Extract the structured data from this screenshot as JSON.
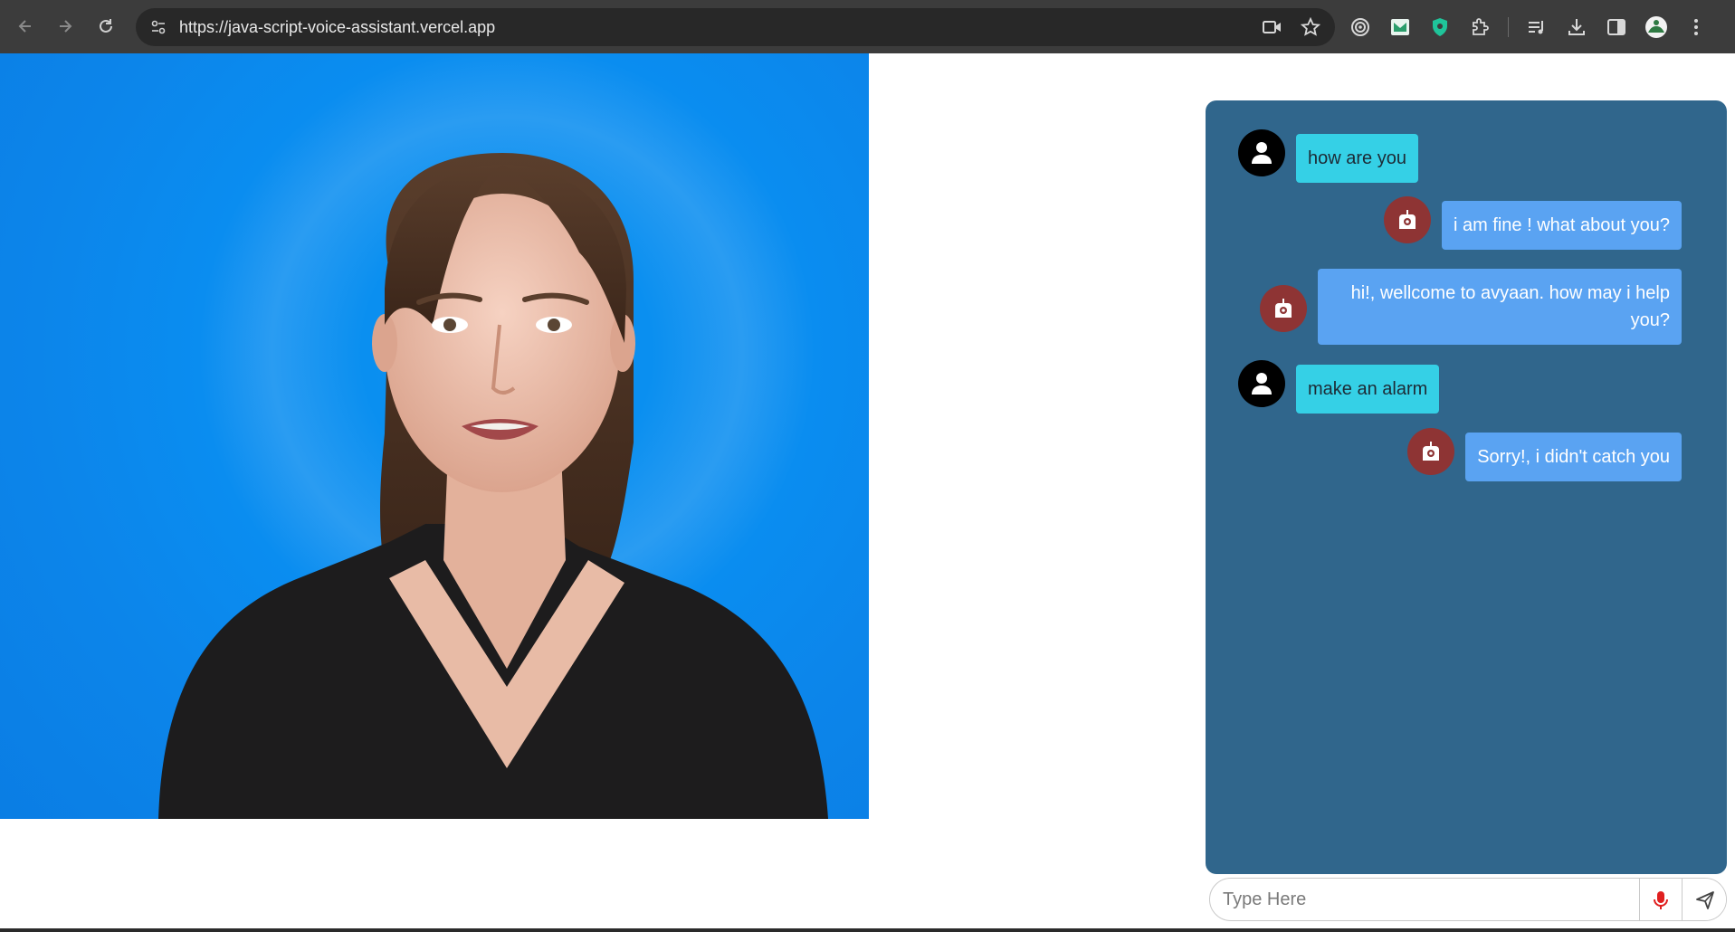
{
  "browser": {
    "url": "https://java-script-voice-assistant.vercel.app",
    "icons": [
      "back-arrow-icon",
      "forward-arrow-icon",
      "reload-icon",
      "site-info-icon",
      "camera-icon",
      "star-icon",
      "extension-icon",
      "reading-list-icon",
      "downloads-icon",
      "side-panel-icon",
      "profile-avatar",
      "more-menu-icon"
    ]
  },
  "colors": {
    "chat_panel": "#30668c",
    "user_bubble": "#35d0e6",
    "bot_bubble": "#5aa3f2",
    "user_avatar": "#000000",
    "bot_avatar": "#8e3434",
    "video_background": "#0a8ff0"
  },
  "chat": {
    "messages": [
      {
        "sender": "user",
        "text": "how are you"
      },
      {
        "sender": "bot",
        "text": "i am fine ! what about you?"
      },
      {
        "sender": "bot",
        "text_line1": "hi!, wellcome to avyaan. how may i help",
        "text_line2": "you?"
      },
      {
        "sender": "user",
        "text": "make an alarm"
      },
      {
        "sender": "bot",
        "text": "Sorry!, i didn't catch you"
      }
    ]
  },
  "input": {
    "placeholder": "Type Here",
    "value": ""
  }
}
